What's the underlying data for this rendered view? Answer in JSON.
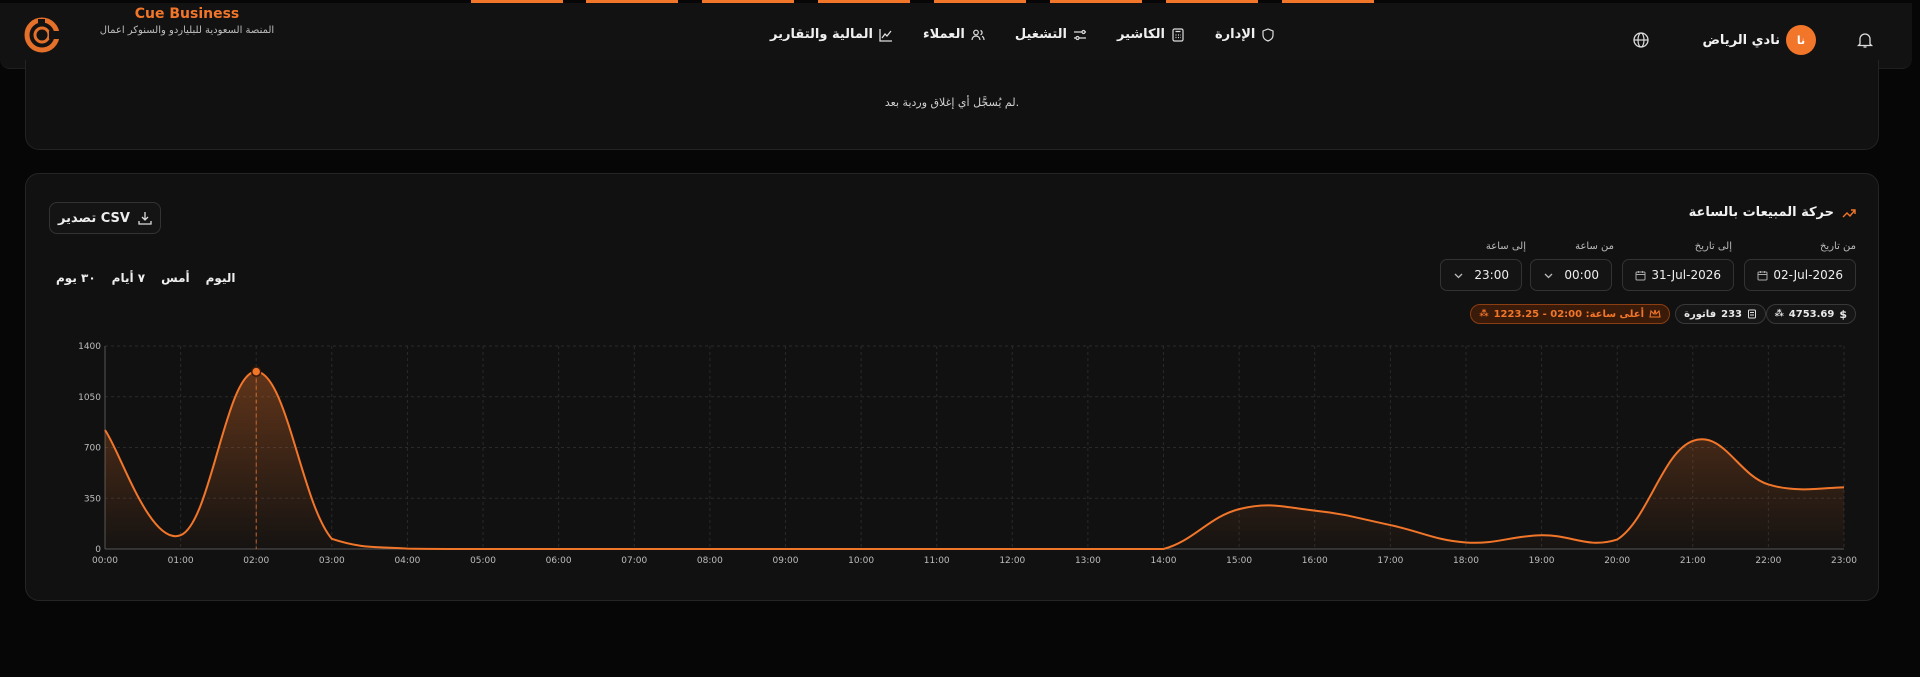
{
  "app": {
    "brand_title": "Cue Business",
    "brand_subtitle": "المنصة السعودية للبلياردو والسنوكر اعمال",
    "accent_color": "#f2762a"
  },
  "nav": {
    "items": [
      {
        "label": "المالية والتقارير",
        "icon": "chart-line-icon"
      },
      {
        "label": "العملاء",
        "icon": "users-icon"
      },
      {
        "label": "التشغيل",
        "icon": "sliders-icon"
      },
      {
        "label": "الكاشير",
        "icon": "calculator-icon"
      },
      {
        "label": "الإدارة",
        "icon": "shield-icon"
      }
    ]
  },
  "user": {
    "name": "نادي الرياض",
    "initials": "نا"
  },
  "shifts_card": {
    "empty_message": "لم يُسجَّل أي إغلاق وردية بعد."
  },
  "sales_card": {
    "title": "حركة المبيعات بالساعة",
    "export_label": "تصدير CSV",
    "from_date_label": "من تاريخ",
    "to_date_label": "إلى تاريخ",
    "from_hour_label": "من ساعة",
    "to_hour_label": "إلى ساعة",
    "from_date": "02-Jul-2026",
    "to_date": "31-Jul-2026",
    "from_hour": "00:00",
    "to_hour": "23:00",
    "ranges": [
      "اليوم",
      "أمس",
      "٧ أيام",
      "٣٠ يوم"
    ],
    "total_amount": "4753.69",
    "invoice_count": "233",
    "invoice_label": "فاتورة",
    "peak_label": "أعلى ساعة: 02:00 - 1223.25"
  },
  "chart_data": {
    "type": "area",
    "x": [
      "00:00",
      "01:00",
      "02:00",
      "03:00",
      "04:00",
      "05:00",
      "06:00",
      "07:00",
      "08:00",
      "09:00",
      "10:00",
      "11:00",
      "12:00",
      "13:00",
      "14:00",
      "15:00",
      "16:00",
      "17:00",
      "18:00",
      "19:00",
      "20:00",
      "21:00",
      "22:00",
      "23:00"
    ],
    "values": [
      820,
      95,
      1223.25,
      70,
      3,
      0,
      0,
      0,
      0,
      0,
      0,
      0,
      0,
      0,
      0,
      275,
      265,
      165,
      45,
      95,
      65,
      745,
      445,
      425
    ],
    "ylim": [
      0,
      1400
    ],
    "yticks": [
      0,
      350,
      700,
      1050,
      1400
    ],
    "ytick_labels": [
      "0",
      "350",
      "700",
      "1050",
      "1400"
    ],
    "highlight_index": 2,
    "grid": true,
    "color": "#f2762a"
  }
}
